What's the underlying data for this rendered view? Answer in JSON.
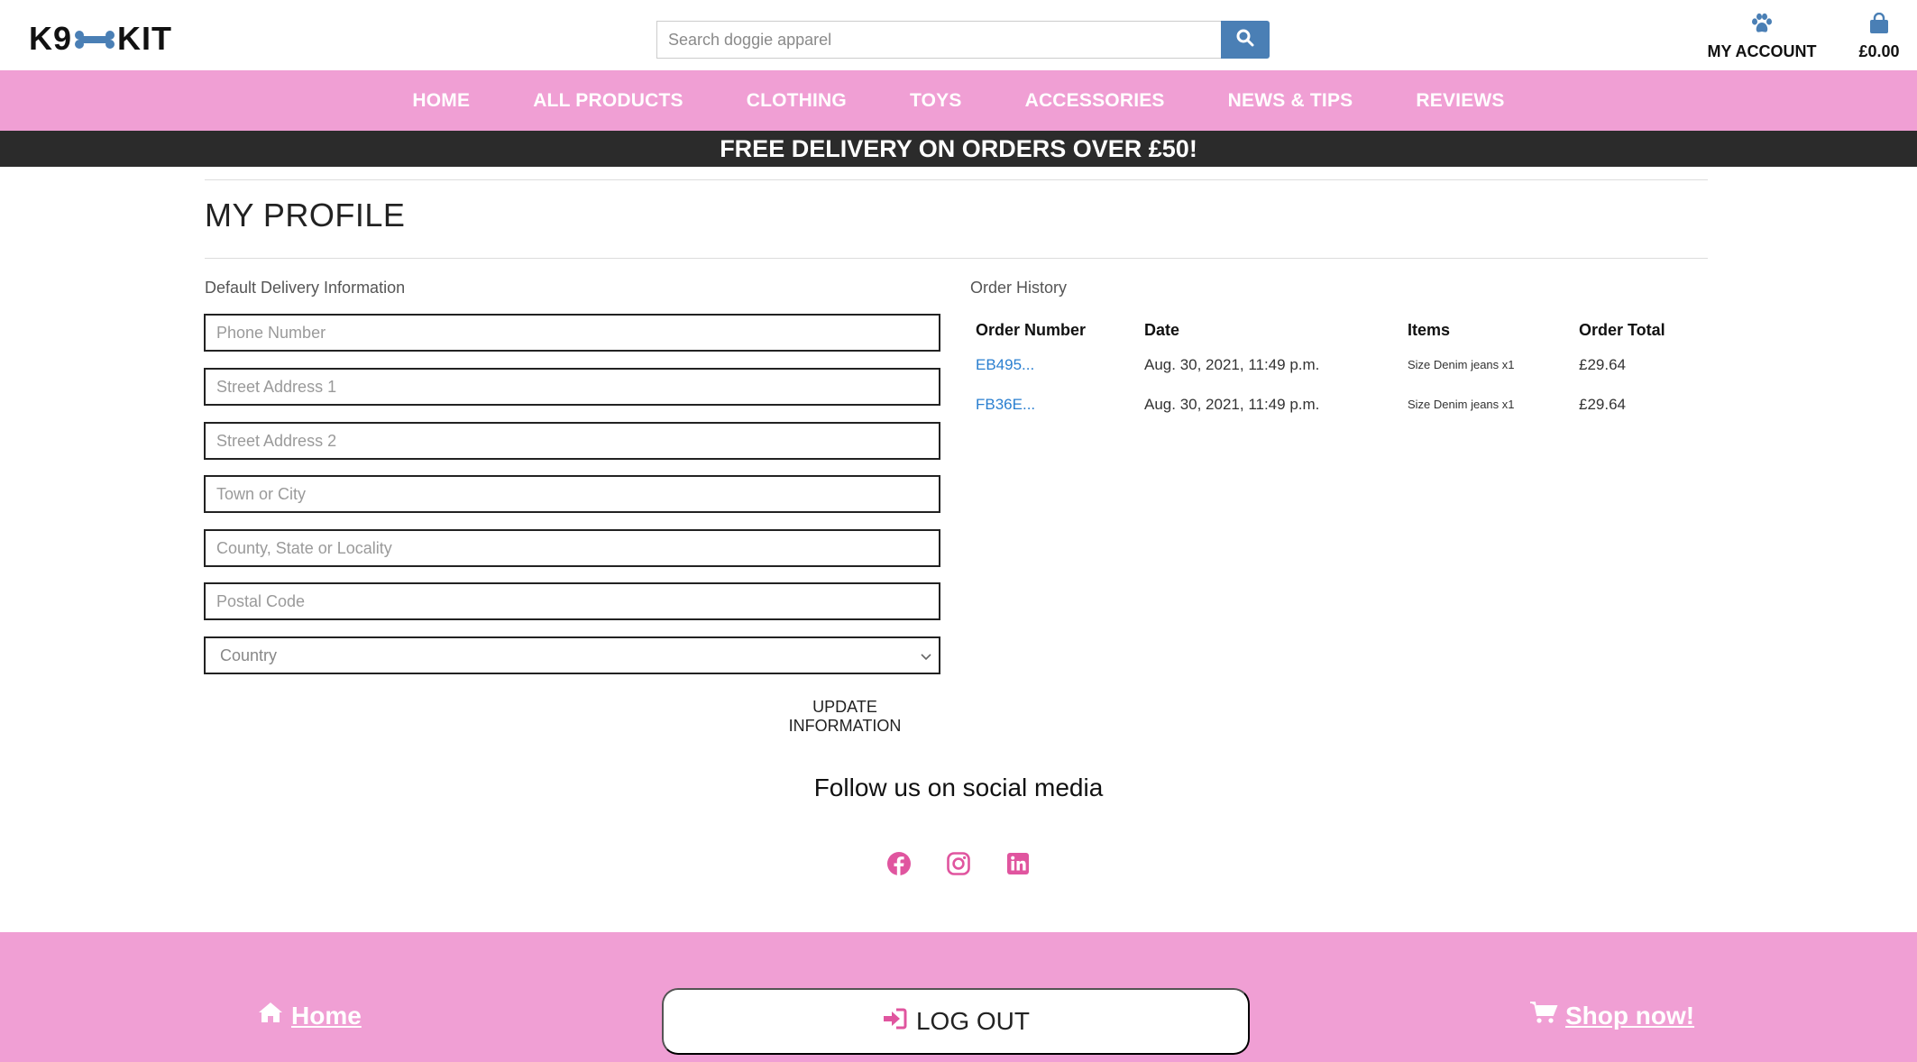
{
  "brand": {
    "logo_left": "K9",
    "logo_right": "KIT",
    "accent": "#f09fd4",
    "bone_color": "#4a7fb5"
  },
  "search": {
    "placeholder": "Search doggie apparel"
  },
  "header": {
    "account_label": "MY ACCOUNT",
    "cart_total": "£0.00"
  },
  "nav": {
    "items": [
      "HOME",
      "ALL PRODUCTS",
      "CLOTHING",
      "TOYS",
      "ACCESSORIES",
      "NEWS & TIPS",
      "REVIEWS"
    ]
  },
  "banner": {
    "text": "FREE DELIVERY ON ORDERS OVER £50!"
  },
  "profile": {
    "title": "MY PROFILE",
    "delivery_label": "Default Delivery Information",
    "fields": {
      "phone": "Phone Number",
      "street1": "Street Address 1",
      "street2": "Street Address 2",
      "town": "Town or City",
      "county": "County, State or Locality",
      "postcode": "Postal Code",
      "country": "Country"
    },
    "update_label": "UPDATE INFORMATION"
  },
  "orders": {
    "label": "Order History",
    "headers": [
      "Order Number",
      "Date",
      "Items",
      "Order Total"
    ],
    "rows": [
      {
        "number": "EB495...",
        "date": "Aug. 30, 2021, 11:49 p.m.",
        "items": "Size Denim jeans x1",
        "total": "£29.64"
      },
      {
        "number": "FB36E...",
        "date": "Aug. 30, 2021, 11:49 p.m.",
        "items": "Size Denim jeans x1",
        "total": "£29.64"
      }
    ]
  },
  "social": {
    "title": "Follow us on social media",
    "icons": [
      "facebook-icon",
      "instagram-icon",
      "linkedin-icon"
    ],
    "color": "#e0559f"
  },
  "footer": {
    "home_label": "Home",
    "logout_label": "LOG OUT",
    "shop_label": "Shop now!"
  }
}
